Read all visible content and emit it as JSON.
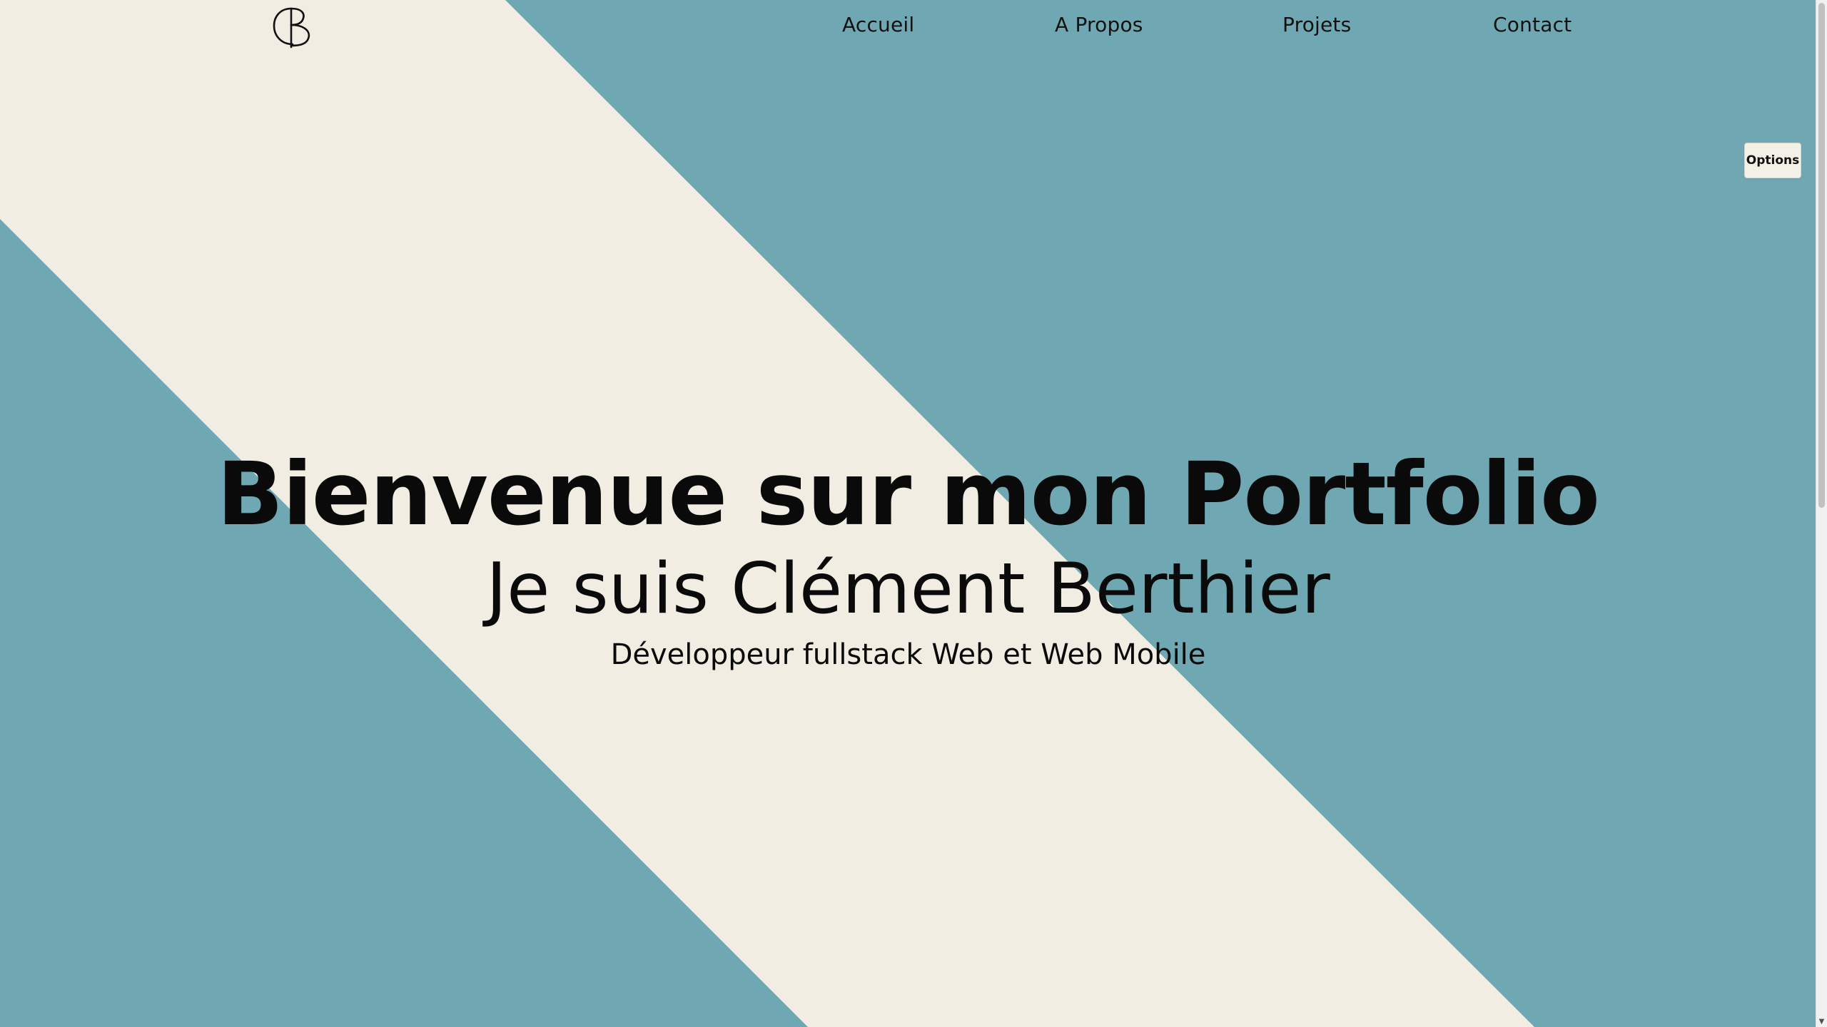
{
  "colors": {
    "teal": "#6fa8b3",
    "cream": "#f1ede3",
    "text": "#0a0a0a"
  },
  "header": {
    "logo_icon": "cb-monogram-logo",
    "nav": [
      {
        "label": "Accueil"
      },
      {
        "label": "A Propos"
      },
      {
        "label": "Projets"
      },
      {
        "label": "Contact"
      }
    ]
  },
  "options_button": {
    "label": "Options"
  },
  "hero": {
    "title": "Bienvenue sur mon Portfolio",
    "name": "Je suis Clément Berthier",
    "role": "Développeur fullstack Web et Web Mobile"
  },
  "scrollbar": {
    "icon": "chevron-down-icon"
  }
}
